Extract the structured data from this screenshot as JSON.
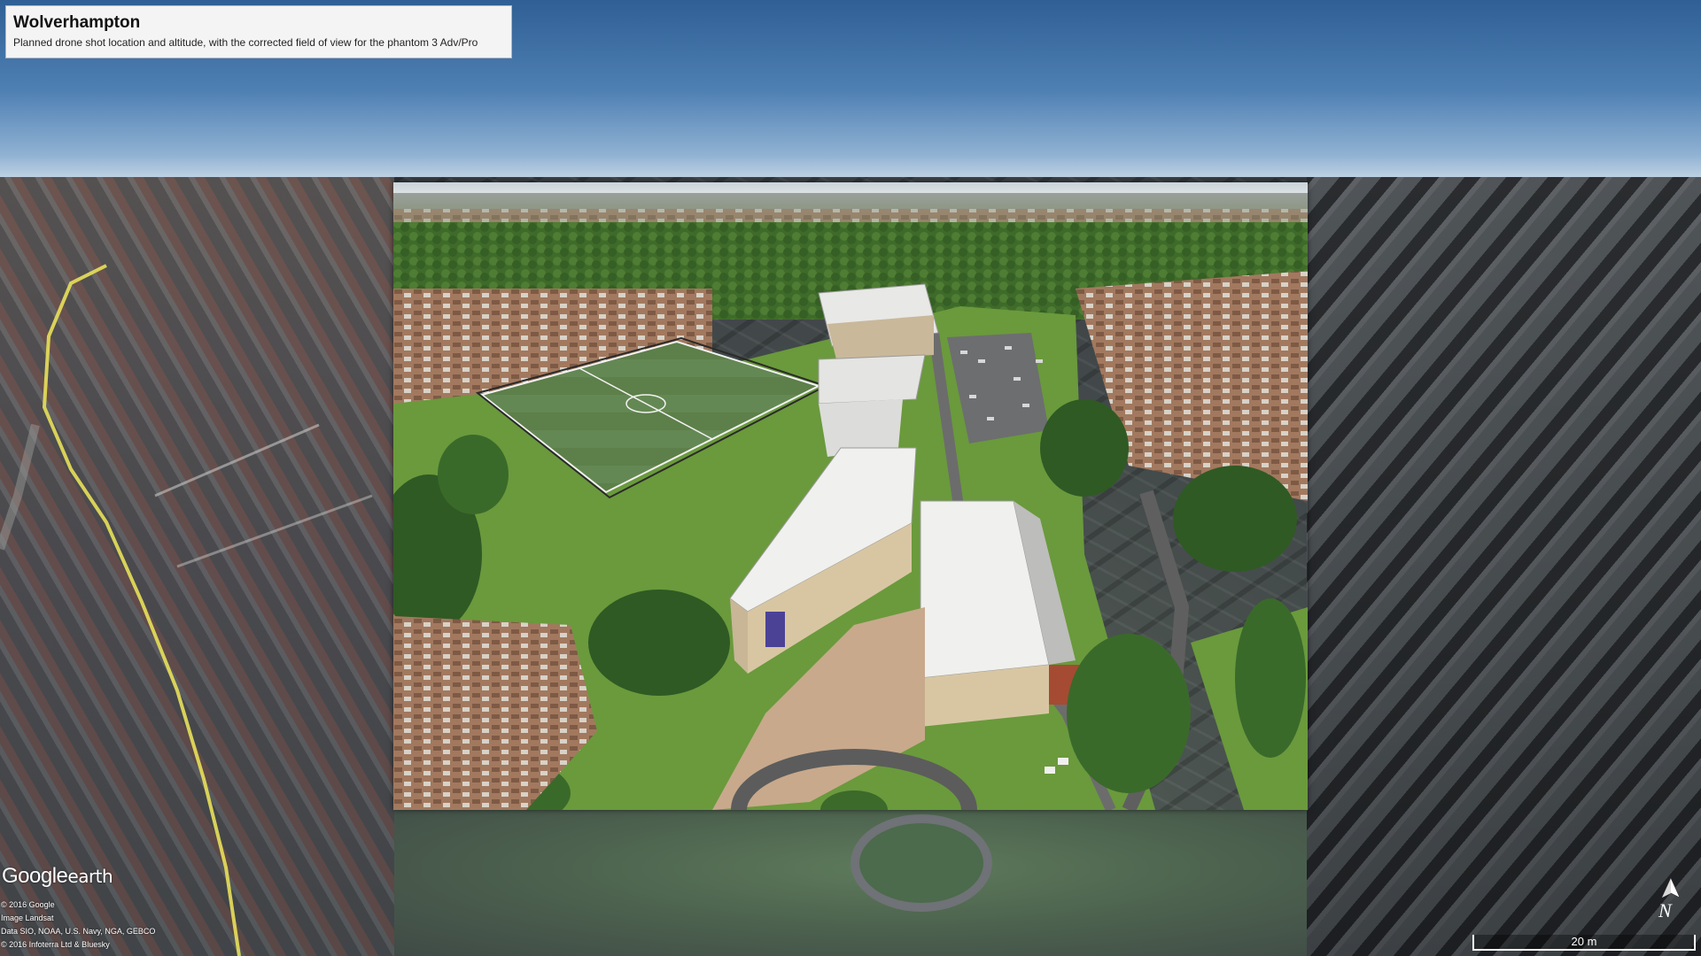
{
  "info": {
    "title": "Wolverhampton",
    "description": "Planned drone shot location and altitude, with the corrected field of view for the phantom 3 Adv/Pro"
  },
  "logo": {
    "google": "Google",
    "earth": "earth"
  },
  "attribution": [
    "© 2016 Google",
    "Image Landsat",
    "Data SIO, NOAA, U.S. Navy, NGA, GEBCO",
    "© 2016 Infoterra Ltd & Bluesky"
  ],
  "compass": {
    "label": "N",
    "icon": "north-arrow-icon"
  },
  "scale": {
    "label": "20 m"
  },
  "colors": {
    "road_highlight": "#e8e05a",
    "info_box_bg": "#f4f4f4",
    "sky_top": "#2f5f95",
    "grass": "#6a9a3c"
  }
}
